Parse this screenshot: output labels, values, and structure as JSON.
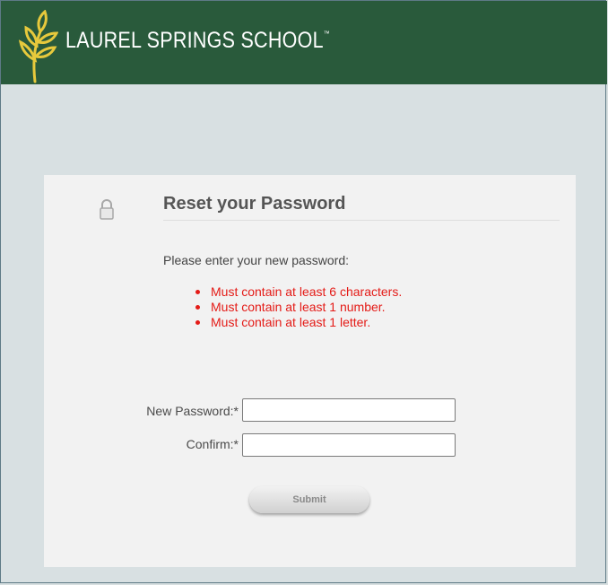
{
  "header": {
    "logo_text": "LAUREL SPRINGS SCHOOL",
    "logo_tm": "™",
    "background_color": "#295a3b",
    "logo_icon": "wheat-sprig-icon",
    "logo_icon_color": "#e7c93c"
  },
  "form": {
    "lock_icon": "lock-icon",
    "title": "Reset your Password",
    "instructions": "Please enter your new password:",
    "rules": [
      "Must contain at least 6 characters.",
      "Must contain at least 1 number.",
      "Must contain at least 1 letter."
    ],
    "rule_color": "#e41b17",
    "fields": {
      "new_password_label": "New Password:*",
      "new_password_value": "",
      "confirm_label": "Confirm:*",
      "confirm_value": ""
    },
    "submit_label": "Submit"
  }
}
